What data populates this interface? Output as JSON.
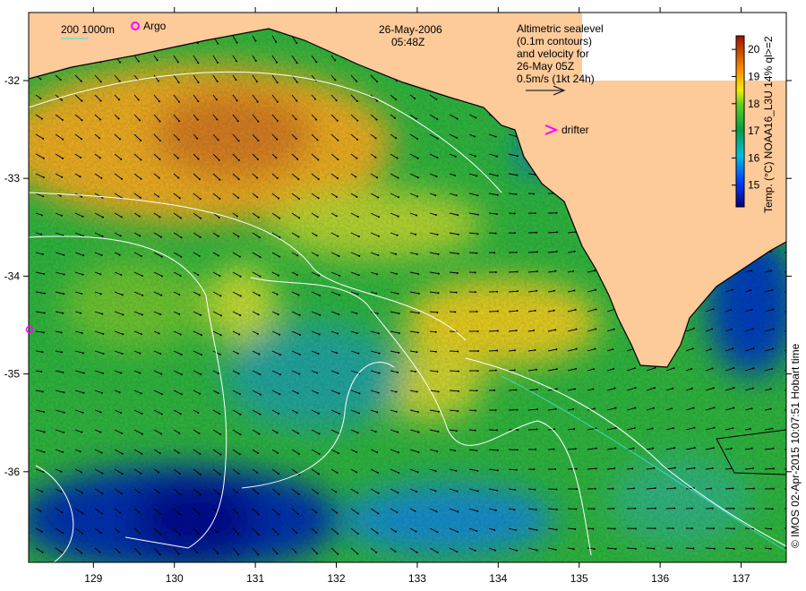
{
  "map": {
    "date": "26-May-2006",
    "time": "05:48Z",
    "legend_depth": "200  1000m",
    "legend_argo": "Argo",
    "legend_drifter": "drifter",
    "altimetry_lines": [
      "Altimetric sealevel",
      "(0.1m contours)",
      "and velocity for",
      "26-May 05Z",
      "0.5m/s (1kt 24h)"
    ],
    "colorbar_label": "Temp. (°C) NOAA16_L3U 14% ql>=2",
    "colorbar_ticks": [
      "15",
      "16",
      "17",
      "18",
      "19",
      "20"
    ],
    "colorbar_range": [
      14.2,
      20.5
    ],
    "credit": "© IMOS 02-Apr-2015 10:07:51 Hobart time",
    "lon_ticks": [
      "129",
      "130",
      "131",
      "132",
      "133",
      "134",
      "135",
      "136",
      "137"
    ],
    "lat_ticks": [
      "-32",
      "-33",
      "-34",
      "-35",
      "-36"
    ],
    "colors": {
      "land": "#fdca9a",
      "argo": "#ff00ff",
      "drifter": "#ff00ff",
      "contour": "#ffffff",
      "isobath": "#40e0e0"
    }
  }
}
